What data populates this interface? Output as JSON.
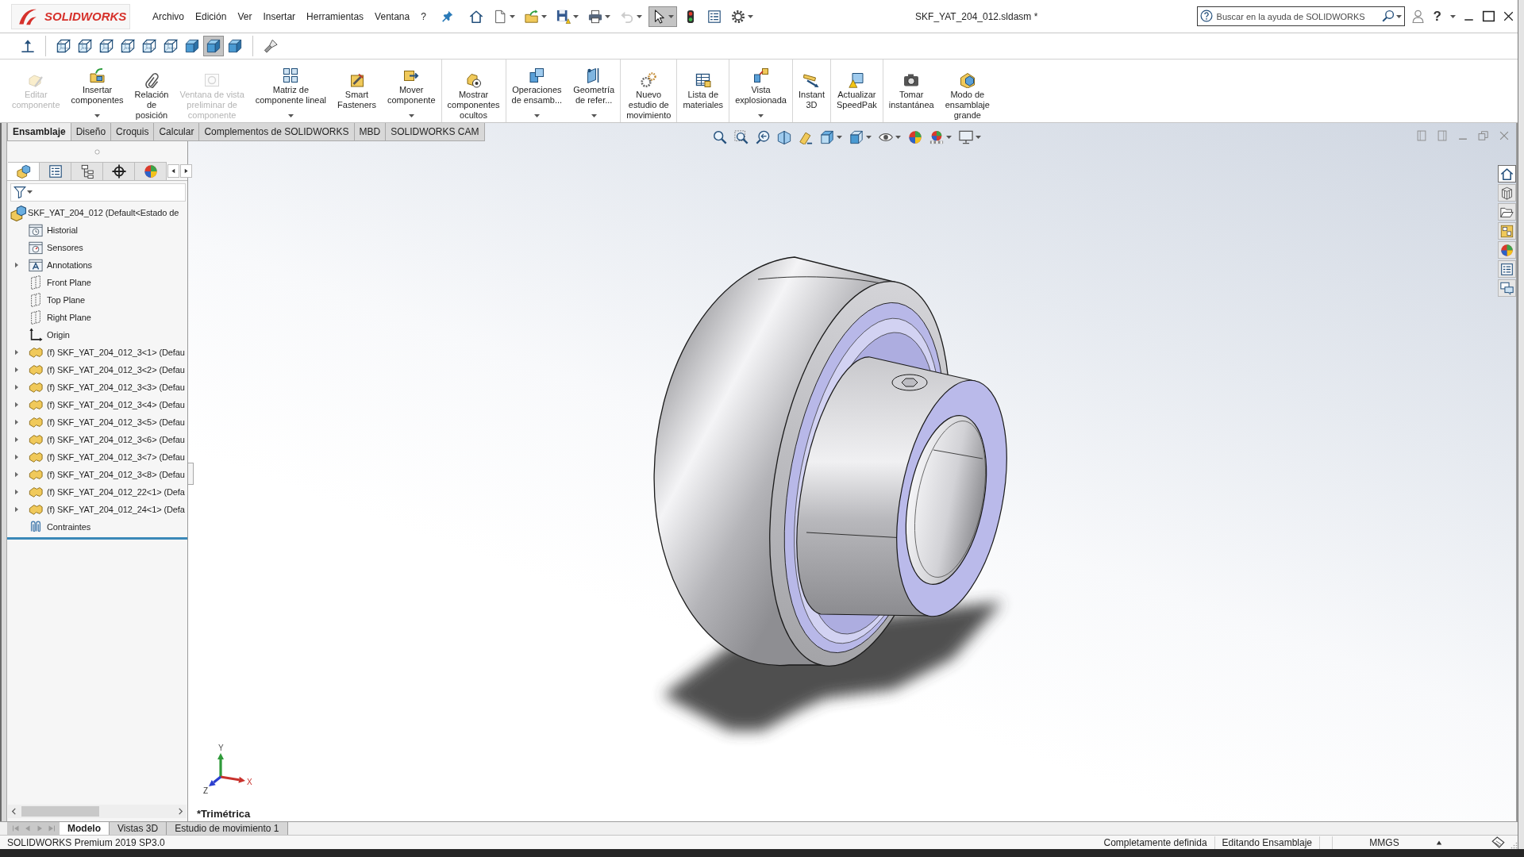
{
  "window": {
    "title": "SKF_YAT_204_012.sldasm *"
  },
  "logo": {
    "text": "SOLIDWORKS"
  },
  "menu": [
    "Archivo",
    "Edición",
    "Ver",
    "Insertar",
    "Herramientas",
    "Ventana",
    "?"
  ],
  "quick_access": [
    {
      "kind": "home",
      "caret": false,
      "disabled": false,
      "selected": false
    },
    {
      "kind": "new",
      "caret": true,
      "disabled": false,
      "selected": false
    },
    {
      "kind": "open",
      "caret": true,
      "disabled": false,
      "selected": false
    },
    {
      "kind": "save",
      "caret": true,
      "disabled": false,
      "selected": false
    },
    {
      "kind": "print",
      "caret": true,
      "disabled": false,
      "selected": false
    },
    {
      "kind": "undo",
      "caret": true,
      "disabled": true,
      "selected": false
    },
    {
      "kind": "select",
      "caret": true,
      "disabled": false,
      "selected": true
    },
    {
      "kind": "rebuild",
      "caret": false,
      "disabled": false,
      "selected": false
    },
    {
      "kind": "properties",
      "caret": false,
      "disabled": false,
      "selected": false
    },
    {
      "kind": "options",
      "caret": true,
      "disabled": false,
      "selected": false
    }
  ],
  "help_search": {
    "placeholder": "Buscar en la ayuda de SOLIDWORKS"
  },
  "help_button": "?",
  "view_toolbar": [
    {
      "kind": "normal-to",
      "selected": false
    },
    {
      "kind": "wireframe",
      "selected": false
    },
    {
      "kind": "wireframe",
      "selected": false
    },
    {
      "kind": "wireframe",
      "selected": false
    },
    {
      "kind": "wireframe",
      "selected": false
    },
    {
      "kind": "wireframe",
      "selected": false
    },
    {
      "kind": "wireframe",
      "selected": false
    },
    {
      "kind": "shaded",
      "selected": false
    },
    {
      "kind": "shaded",
      "selected": true
    },
    {
      "kind": "shaded",
      "selected": false
    },
    {
      "kind": "light",
      "selected": false
    }
  ],
  "command_manager": {
    "groups": [
      [
        {
          "label": "Editar\ncomponente",
          "kind": "edit",
          "caret": false,
          "disabled": true
        },
        {
          "label": "Insertar\ncomponentes",
          "kind": "insert",
          "caret": true,
          "disabled": false
        },
        {
          "label": "Relación\nde\nposición",
          "kind": "mate",
          "caret": false,
          "disabled": false
        },
        {
          "label": "Ventana de vista\npreliminar de\ncomponente",
          "kind": "preview",
          "caret": false,
          "disabled": true
        },
        {
          "label": "Matriz de\ncomponente lineal",
          "kind": "pattern",
          "caret": true,
          "disabled": false
        },
        {
          "label": "Smart\nFasteners",
          "kind": "fastener",
          "caret": false,
          "disabled": false
        },
        {
          "label": "Mover\ncomponente",
          "kind": "move",
          "caret": true,
          "disabled": false
        }
      ],
      [
        {
          "label": "Mostrar\ncomponentes\nocultos",
          "kind": "show-hidden",
          "caret": false,
          "disabled": false
        }
      ],
      [
        {
          "label": "Operaciones\nde ensamb...",
          "kind": "features",
          "caret": true,
          "disabled": false
        },
        {
          "label": "Geometría\nde refer...",
          "kind": "reference",
          "caret": true,
          "disabled": false
        }
      ],
      [
        {
          "label": "Nuevo\nestudio de\nmovimiento",
          "kind": "motion",
          "caret": false,
          "disabled": false
        }
      ],
      [
        {
          "label": "Lista de\nmateriales",
          "kind": "bom",
          "caret": false,
          "disabled": false
        }
      ],
      [
        {
          "label": "Vista\nexplosionada",
          "kind": "explode",
          "caret": true,
          "disabled": false
        }
      ],
      [
        {
          "label": "Instant\n3D",
          "kind": "instant3d",
          "caret": false,
          "disabled": false
        }
      ],
      [
        {
          "label": "Actualizar\nSpeedPak",
          "kind": "speedpak",
          "caret": false,
          "disabled": false
        }
      ],
      [
        {
          "label": "Tomar\ninstantánea",
          "kind": "camera",
          "caret": false,
          "disabled": false
        },
        {
          "label": "Modo de\nensamblaje\ngrande",
          "kind": "large",
          "caret": false,
          "disabled": false
        }
      ]
    ]
  },
  "tabs": [
    {
      "label": "Ensamblaje",
      "selected": true
    },
    {
      "label": "Diseño",
      "selected": false
    },
    {
      "label": "Croquis",
      "selected": false
    },
    {
      "label": "Calcular",
      "selected": false
    },
    {
      "label": "Complementos de SOLIDWORKS",
      "selected": false
    },
    {
      "label": "MBD",
      "selected": false
    },
    {
      "label": "SOLIDWORKS CAM",
      "selected": false
    }
  ],
  "feature_manager": {
    "panel_tabs": [
      {
        "kind": "tree",
        "selected": true
      },
      {
        "kind": "properties",
        "selected": false
      },
      {
        "kind": "configurations",
        "selected": false
      },
      {
        "kind": "dimxpert",
        "selected": false
      },
      {
        "kind": "appearance",
        "selected": false
      }
    ],
    "root": {
      "label": "SKF_YAT_204_012 (Default<Estado de"
    },
    "items": [
      {
        "label": "Historial",
        "kind": "history",
        "expandable": false
      },
      {
        "label": "Sensores",
        "kind": "sensors",
        "expandable": false
      },
      {
        "label": "Annotations",
        "kind": "annotations",
        "expandable": true
      },
      {
        "label": "Front Plane",
        "kind": "plane",
        "expandable": false
      },
      {
        "label": "Top Plane",
        "kind": "plane",
        "expandable": false
      },
      {
        "label": "Right Plane",
        "kind": "plane",
        "expandable": false
      },
      {
        "label": "Origin",
        "kind": "origin",
        "expandable": false
      },
      {
        "label": "(f) SKF_YAT_204_012_3<1> (Defau",
        "kind": "part",
        "expandable": true
      },
      {
        "label": "(f) SKF_YAT_204_012_3<2> (Defau",
        "kind": "part",
        "expandable": true
      },
      {
        "label": "(f) SKF_YAT_204_012_3<3> (Defau",
        "kind": "part",
        "expandable": true
      },
      {
        "label": "(f) SKF_YAT_204_012_3<4> (Defau",
        "kind": "part",
        "expandable": true
      },
      {
        "label": "(f) SKF_YAT_204_012_3<5> (Defau",
        "kind": "part",
        "expandable": true
      },
      {
        "label": "(f) SKF_YAT_204_012_3<6> (Defau",
        "kind": "part",
        "expandable": true
      },
      {
        "label": "(f) SKF_YAT_204_012_3<7> (Defau",
        "kind": "part",
        "expandable": true
      },
      {
        "label": "(f) SKF_YAT_204_012_3<8> (Defau",
        "kind": "part",
        "expandable": true
      },
      {
        "label": "(f) SKF_YAT_204_012_22<1> (Defa",
        "kind": "part",
        "expandable": true
      },
      {
        "label": "(f) SKF_YAT_204_012_24<1> (Defa",
        "kind": "part",
        "expandable": true
      },
      {
        "label": "Contraintes",
        "kind": "mates",
        "expandable": false
      }
    ]
  },
  "viewport": {
    "heads_up": [
      {
        "kind": "zoom-fit",
        "caret": false
      },
      {
        "kind": "zoom-area",
        "caret": false
      },
      {
        "kind": "previous",
        "caret": false
      },
      {
        "kind": "section",
        "caret": false
      },
      {
        "kind": "annotation",
        "caret": false
      },
      {
        "kind": "orientation",
        "caret": true
      },
      {
        "kind": "display",
        "caret": true
      },
      {
        "kind": "hide-show",
        "caret": true
      },
      {
        "kind": "appearance",
        "caret": false
      },
      {
        "kind": "scene",
        "caret": true
      },
      {
        "kind": "settings",
        "caret": true
      }
    ],
    "task_pane": [
      {
        "kind": "home",
        "selected": true
      },
      {
        "kind": "parts",
        "selected": false
      },
      {
        "kind": "folder",
        "selected": false
      },
      {
        "kind": "palette",
        "selected": false
      },
      {
        "kind": "appearance",
        "selected": false
      },
      {
        "kind": "properties",
        "selected": false
      },
      {
        "kind": "forum",
        "selected": false
      }
    ],
    "triad": [
      {
        "kind": "y",
        "label": "Y"
      },
      {
        "kind": "x",
        "label": "X"
      },
      {
        "kind": "z",
        "label": "Z"
      }
    ],
    "view_name": "*Trimétrica"
  },
  "bottom_tabs": [
    {
      "label": "Modelo",
      "selected": true
    },
    {
      "label": "Vistas 3D",
      "selected": false
    },
    {
      "label": "Estudio de movimiento 1",
      "selected": false
    }
  ],
  "status_bar": {
    "product": "SOLIDWORKS Premium 2019 SP3.0",
    "items": [
      "Completamente definida",
      "Editando Ensamblaje"
    ],
    "units": "MMGS"
  }
}
